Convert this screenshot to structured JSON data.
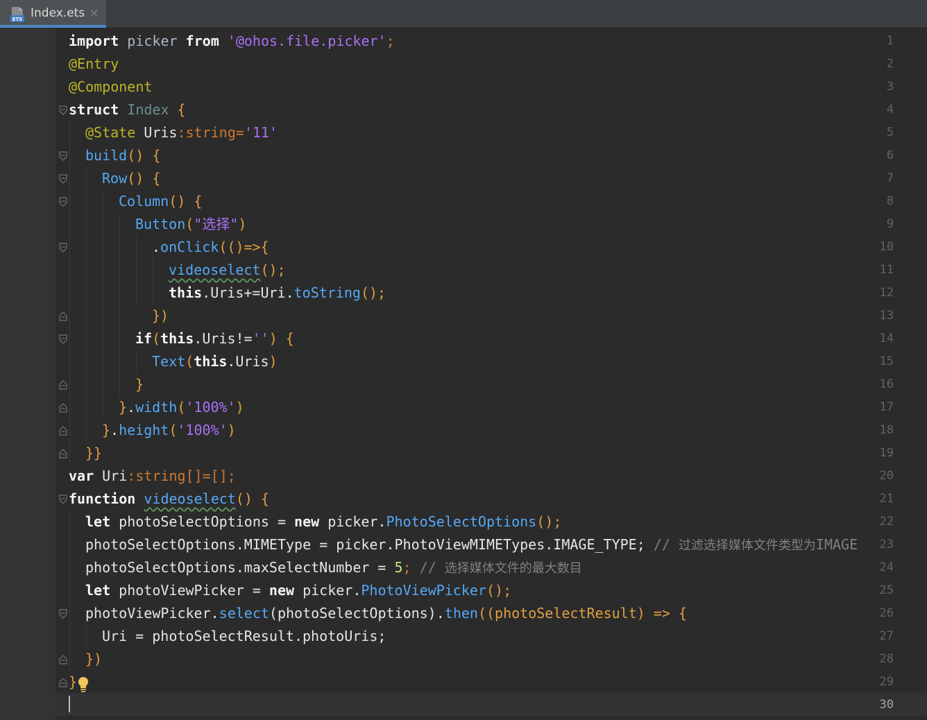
{
  "tab": {
    "file_name": "Index.ets",
    "close_glyph": "×",
    "file_icon": "ets-file-icon"
  },
  "lines": [
    "1",
    "2",
    "3",
    "4",
    "5",
    "6",
    "7",
    "8",
    "9",
    "10",
    "11",
    "12",
    "13",
    "14",
    "15",
    "16",
    "17",
    "18",
    "19",
    "20",
    "21",
    "22",
    "23",
    "24",
    "25",
    "26",
    "27",
    "28",
    "29",
    "30"
  ],
  "code": {
    "l1": {
      "a": "import",
      "b": " picker ",
      "c": "from",
      "d": " ",
      "e": "'@ohos.file.picker'",
      "f": ";"
    },
    "l2": "@Entry",
    "l3": "@Component",
    "l4": {
      "a": "struct",
      "b": " ",
      "c": "Index",
      "d": " {"
    },
    "l5": {
      "a": "@State",
      "b": " Uris",
      "c": ":",
      "d": "string",
      "e": "=",
      "f": "'11'"
    },
    "l6": {
      "a": "build",
      "b": "() {"
    },
    "l7": {
      "a": "Row",
      "b": "() {"
    },
    "l8": {
      "a": "Column",
      "b": "() {"
    },
    "l9": {
      "a": "Button",
      "b": "(",
      "c": "\"选择\"",
      "d": ")"
    },
    "l10": {
      "a": ".",
      "b": "onClick",
      "c": "(()=>{"
    },
    "l11": {
      "a": "videoselect",
      "b": "();"
    },
    "l12": {
      "a": "this",
      "b": ".Uris+=Uri.",
      "c": "toString",
      "d": "();"
    },
    "l13": "})",
    "l14": {
      "a": "if",
      "b": "(",
      "c": "this",
      "d": ".Uris!=",
      "e": "''",
      "f": ") {"
    },
    "l15": {
      "a": "Text",
      "b": "(",
      "c": "this",
      "d": ".Uris",
      "e": ")"
    },
    "l16": "}",
    "l17": {
      "a": "}",
      "b": ".",
      "c": "width",
      "d": "(",
      "e": "'100%'",
      "f": ")"
    },
    "l18": {
      "a": "}",
      "b": ".",
      "c": "height",
      "d": "(",
      "e": "'100%'",
      "f": ")"
    },
    "l19": "}}",
    "l20": {
      "a": "var",
      "b": " Uri",
      "c": ":",
      "d": "string",
      "e": "[]=[];"
    },
    "l21": {
      "a": "function",
      "b": " ",
      "c": "videoselect",
      "d": "() {"
    },
    "l22": {
      "a": "let",
      "b": " photoSelectOptions = ",
      "c": "new",
      "d": " picker.",
      "e": "PhotoSelectOptions",
      "f": "();"
    },
    "l23": {
      "a": "photoSelectOptions.MIMEType = picker.PhotoViewMIMETypes.IMAGE_TYPE; ",
      "b": "// ",
      "c": "过滤选择媒体文件类型为",
      "d": "IMAGE"
    },
    "l24": {
      "a": "photoSelectOptions.maxSelectNumber = ",
      "b": "5",
      "c": "; ",
      "d": "// ",
      "e": "选择媒体文件的最大数目"
    },
    "l25": {
      "a": "let",
      "b": " photoViewPicker = ",
      "c": "new",
      "d": " picker.",
      "e": "PhotoViewPicker",
      "f": "();"
    },
    "l26": {
      "a": "photoViewPicker.",
      "b": "select",
      "c": "(photoSelectOptions).",
      "d": "then",
      "e": "((photoSelectResult) => {"
    },
    "l27": "Uri = photoSelectResult.photoUris;",
    "l28": "})",
    "l29": "}",
    "l30": ""
  },
  "colors": {
    "background": "#2b2b2b",
    "gutter": "#313335",
    "tab_active_underline": "#4a88c7",
    "string": "#a971f7",
    "annotation": "#bbb529",
    "function": "#56a8f5",
    "type": "#cc7832",
    "comment": "#808080"
  }
}
